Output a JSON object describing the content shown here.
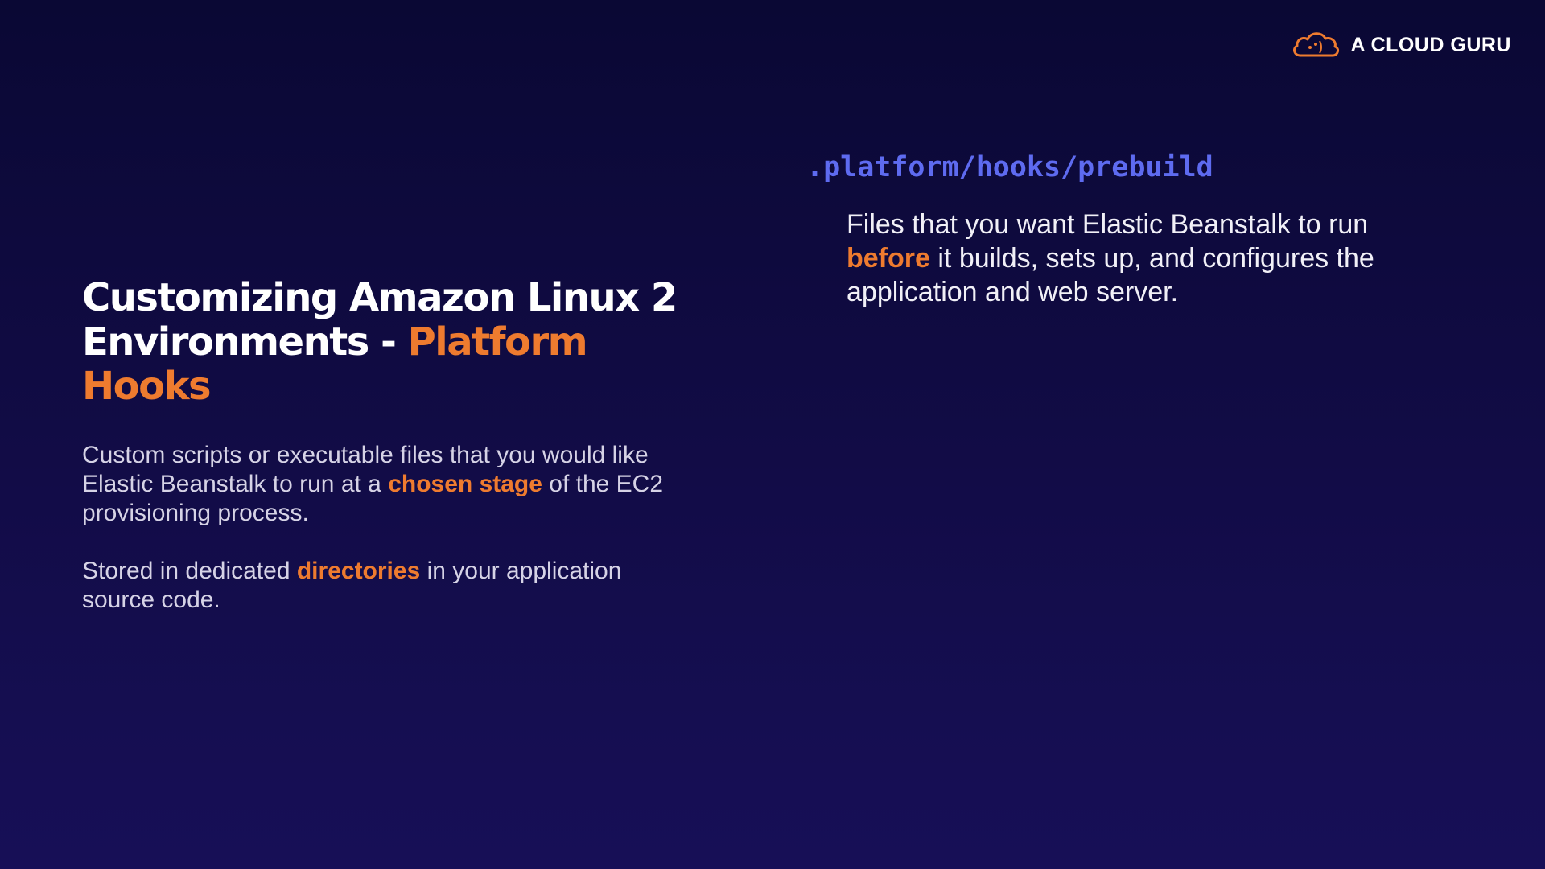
{
  "brand": {
    "name": "A CLOUD GURU",
    "logo_icon": "cloud-icon",
    "accent_color": "#ee7b2f",
    "code_color": "#5e6bf0"
  },
  "slide": {
    "title_line1": "Customizing Amazon Linux 2",
    "title_line2_prefix": "Environments - ",
    "title_line2_accent": "Platform Hooks",
    "desc1_part1": "Custom scripts or executable files that you would like Elastic Beanstalk to run at a ",
    "desc1_highlight": "chosen stage",
    "desc1_part2": " of the EC2 provisioning process.",
    "desc2_part1": "Stored in dedicated ",
    "desc2_highlight": "directories",
    "desc2_part2": " in your application source code.",
    "code_path": ".platform/hooks/prebuild",
    "code_desc_part1": "Files that you want Elastic Beanstalk to run ",
    "code_desc_highlight": "before",
    "code_desc_part2": " it builds, sets up, and configures the application and web server."
  }
}
